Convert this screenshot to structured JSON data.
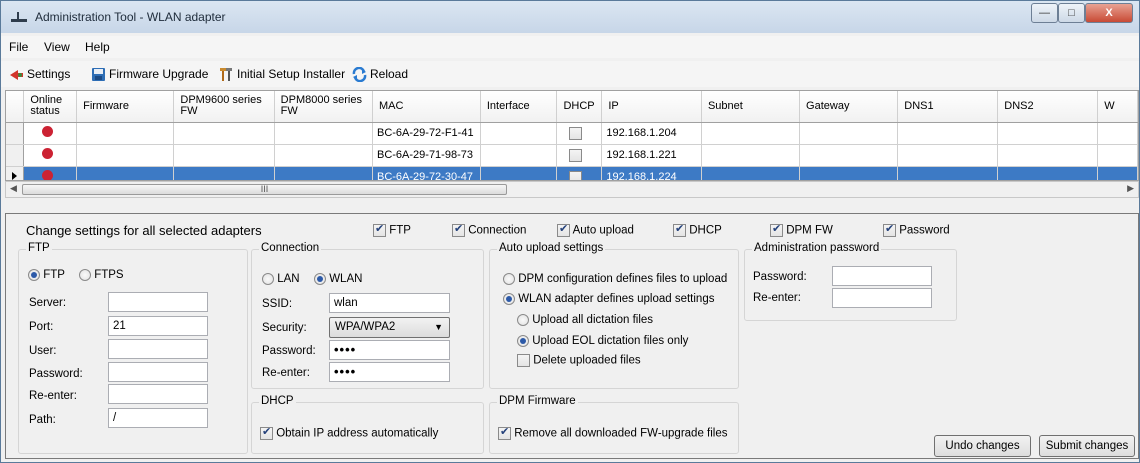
{
  "window": {
    "title": "Administration Tool - WLAN adapter",
    "minimize": "—",
    "maximize": "□",
    "close": "X"
  },
  "menu": [
    "File",
    "View",
    "Help"
  ],
  "toolbar": [
    {
      "label": "Settings",
      "icon": "settings-icon"
    },
    {
      "label": "Firmware Upgrade",
      "icon": "save-icon"
    },
    {
      "label": "Initial Setup Installer",
      "icon": "tools-icon"
    },
    {
      "label": "Reload",
      "icon": "reload-icon"
    }
  ],
  "grid": {
    "headers": [
      "Online status",
      "Firmware",
      "DPM9600 series FW",
      "DPM8000 series FW",
      "MAC",
      "Interface",
      "DHCP",
      "IP",
      "Subnet",
      "Gateway",
      "DNS1",
      "DNS2",
      "W"
    ],
    "rows": [
      {
        "online": true,
        "mac": "BC-6A-29-72-F1-41",
        "dhcp": false,
        "ip": "192.168.1.204",
        "selected": false
      },
      {
        "online": true,
        "mac": "BC-6A-29-71-98-73",
        "dhcp": false,
        "ip": "192.168.1.221",
        "selected": false
      },
      {
        "online": true,
        "mac": "BC-6A-29-72-30-47",
        "dhcp": false,
        "ip": "192.168.1.224",
        "selected": true
      }
    ],
    "scroll_thumb": "III"
  },
  "settings": {
    "heading": "Change settings for all selected adapters",
    "apply": {
      "ftp": "FTP",
      "connection": "Connection",
      "auto_upload": "Auto upload",
      "dhcp": "DHCP",
      "dpm_fw": "DPM FW",
      "password": "Password"
    },
    "ftp": {
      "legend": "FTP",
      "ftp_label": "FTP",
      "ftps_label": "FTPS",
      "mode": "FTP",
      "server_label": "Server:",
      "server": "",
      "port_label": "Port:",
      "port": "21",
      "user_label": "User:",
      "user": "",
      "password_label": "Password:",
      "password": "",
      "reenter_label": "Re-enter:",
      "reenter": "",
      "path_label": "Path:",
      "path": "/"
    },
    "connection": {
      "legend": "Connection",
      "lan_label": "LAN",
      "wlan_label": "WLAN",
      "mode": "WLAN",
      "ssid_label": "SSID:",
      "ssid": "wlan",
      "security_label": "Security:",
      "security": "WPA/WPA2",
      "password_label": "Password:",
      "password": "••••",
      "reenter_label": "Re-enter:",
      "reenter": "••••"
    },
    "dhcp": {
      "legend": "DHCP",
      "obtain_label": "Obtain IP address automatically",
      "obtain": true
    },
    "auto_upload": {
      "legend": "Auto upload settings",
      "dpm_defines": "DPM configuration defines files to upload",
      "wlan_defines": "WLAN adapter defines upload settings",
      "upload_all": "Upload all dictation files",
      "upload_eol": "Upload EOL dictation files only",
      "delete_uploaded": "Delete uploaded files"
    },
    "dpm_firmware": {
      "legend": "DPM Firmware",
      "remove_label": "Remove all downloaded FW-upgrade files",
      "remove": true
    },
    "admin_password": {
      "legend": "Administration password",
      "password_label": "Password:",
      "reenter_label": "Re-enter:"
    },
    "undo_label": "Undo changes",
    "submit_label": "Submit changes"
  }
}
